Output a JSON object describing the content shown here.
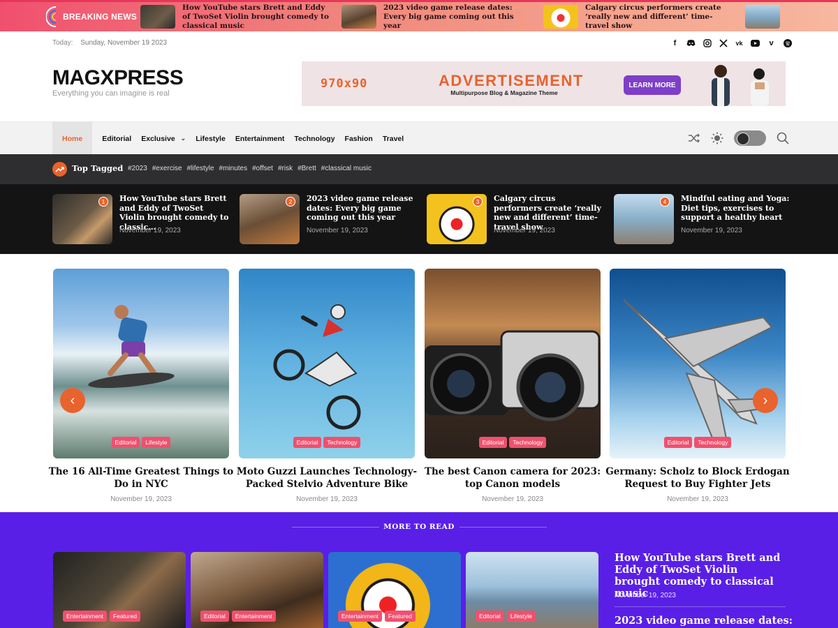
{
  "breaking": {
    "label": "BREAKING NEWS",
    "items": [
      {
        "title": "How YouTube stars Brett and Eddy of TwoSet Violin brought comedy to classical music"
      },
      {
        "title": "2023 video game release dates: Every big game coming out this year"
      },
      {
        "title": "Calgary circus performers create ‘really new and different’ time-travel show"
      }
    ]
  },
  "header": {
    "today_label": "Today:",
    "today_date": "Sunday, November 19 2023",
    "logo": "MAGXPRESS",
    "tagline": "Everything you can imagine is real",
    "socials": [
      "facebook-icon",
      "discord-icon",
      "instagram-icon",
      "x-icon",
      "vk-icon",
      "youtube-icon",
      "vimeo-icon",
      "spotify-icon"
    ]
  },
  "ad": {
    "size": "970x90",
    "headline": "ADVERTISEMENT",
    "subline": "Multipurpose Blog & Magazine Theme",
    "button": "LEARN MORE"
  },
  "nav": {
    "items": [
      "Home",
      "Editorial",
      "Exclusive",
      "Lifestyle",
      "Entertainment",
      "Technology",
      "Fashion",
      "Travel"
    ]
  },
  "tagged": {
    "title": "Top Tagged",
    "tags": [
      "#2023",
      "#exercise",
      "#lifestyle",
      "#minutes",
      "#offset",
      "#risk",
      "#Brett",
      "#classical music"
    ]
  },
  "trending": [
    {
      "num": "1",
      "title": "How YouTube stars Brett and Eddy of TwoSet Violin brought comedy to classic…",
      "date": "November 19, 2023"
    },
    {
      "num": "2",
      "title": "2023 video game release dates: Every big game coming out this year",
      "date": "November 19, 2023"
    },
    {
      "num": "3",
      "title": "Calgary circus performers create ‘really new and different’ time-travel show",
      "date": "November 19, 2023"
    },
    {
      "num": "4",
      "title": "Mindful eating and Yoga: Diet tips, exercises to support a healthy heart",
      "date": "November 19, 2023"
    }
  ],
  "slider": [
    {
      "title": "The 16 All-Time Greatest Things to Do in NYC",
      "date": "November 19, 2023",
      "cats": [
        "Editorial",
        "Lifestyle"
      ]
    },
    {
      "title": "Moto Guzzi Launches Technology-Packed Stelvio Adventure Bike",
      "date": "November 19, 2023",
      "cats": [
        "Editorial",
        "Technology"
      ]
    },
    {
      "title": "The best Canon camera for 2023: top Canon models",
      "date": "November 19, 2023",
      "cats": [
        "Editorial",
        "Technology"
      ]
    },
    {
      "title": "Germany: Scholz to Block Erdogan Request to Buy Fighter Jets",
      "date": "November 19, 2023",
      "cats": [
        "Editorial",
        "Technology"
      ]
    }
  ],
  "more": {
    "heading": "MORE TO READ",
    "cards": [
      {
        "cats": [
          "Entertainment",
          "Featured"
        ]
      },
      {
        "cats": [
          "Editorial",
          "Entertainment"
        ]
      },
      {
        "cats": [
          "Entertainment",
          "Featured"
        ]
      },
      {
        "cats": [
          "Editorial",
          "Lifestyle"
        ]
      }
    ],
    "side": [
      {
        "title": "How YouTube stars Brett and Eddy of TwoSet Violin brought comedy to classical music",
        "date": "November 19, 2023"
      },
      {
        "title": "2023 video game release dates:"
      }
    ]
  },
  "colors": {
    "accent": "#e8632d",
    "badge": "#f0506e",
    "more_bg": "#5a1fe6"
  }
}
